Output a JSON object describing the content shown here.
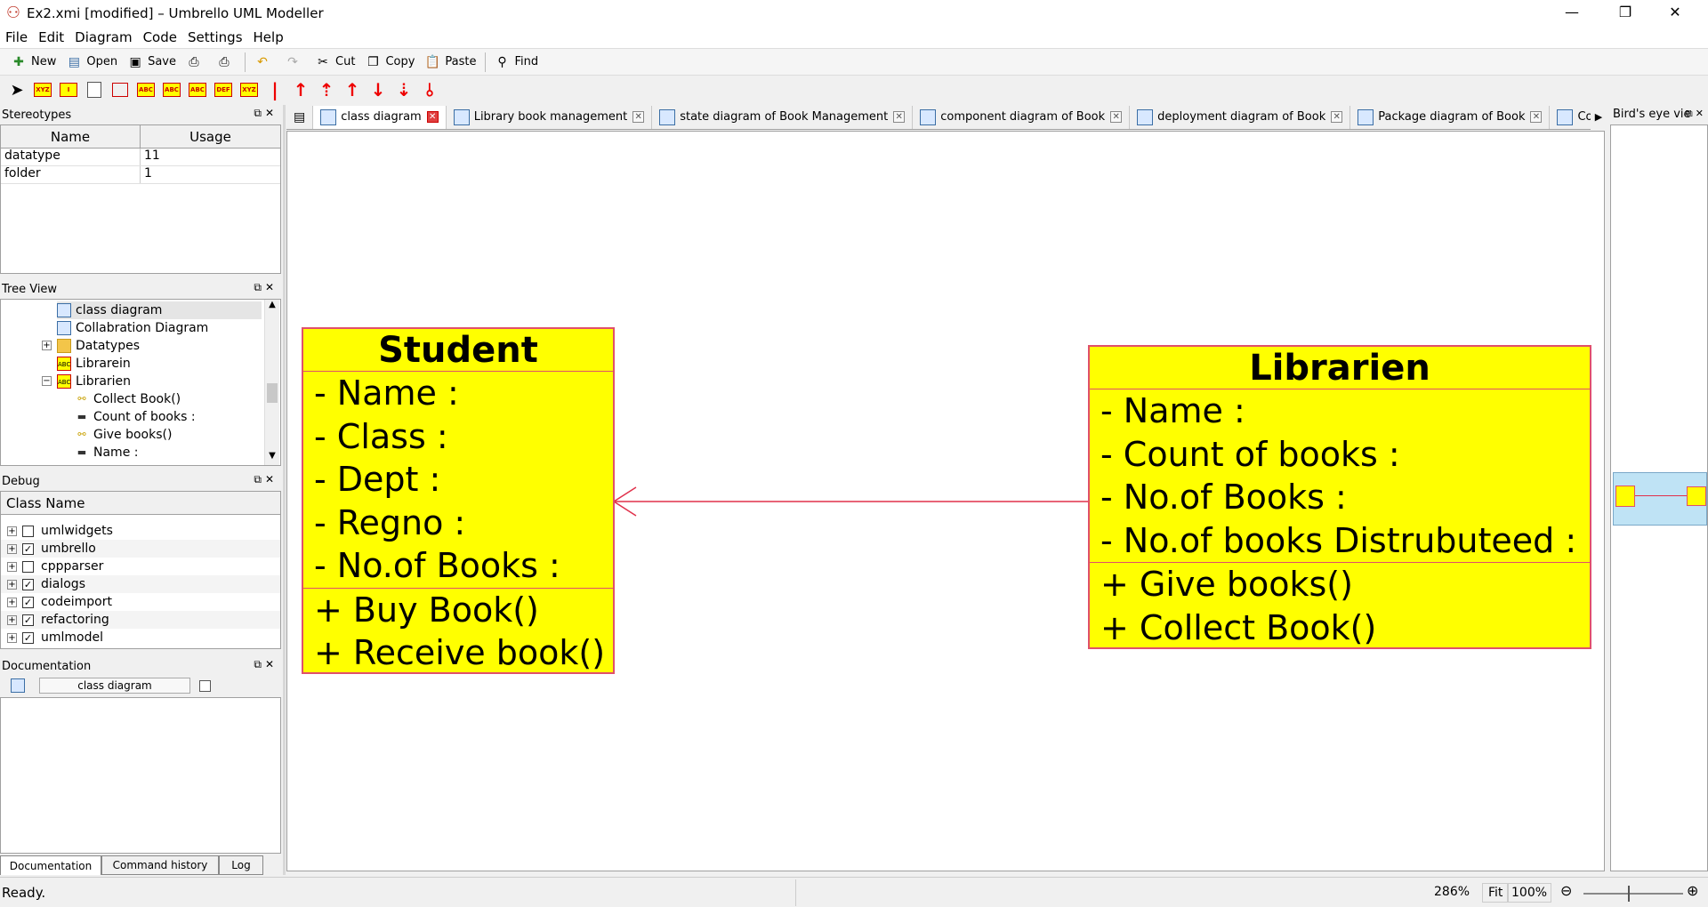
{
  "window": {
    "title": "Ex2.xmi [modified] – Umbrello UML Modeller",
    "minimize": "—",
    "restore": "❐",
    "close": "✕"
  },
  "menu": [
    "File",
    "Edit",
    "Diagram",
    "Code",
    "Settings",
    "Help"
  ],
  "toolbar": {
    "new": "New",
    "open": "Open",
    "save": "Save",
    "cut": "Cut",
    "copy": "Copy",
    "paste": "Paste",
    "find": "Find"
  },
  "stereotypes": {
    "title": "Stereotypes",
    "col_name": "Name",
    "col_usage": "Usage",
    "rows": [
      {
        "name": "datatype",
        "usage": "11"
      },
      {
        "name": "folder",
        "usage": "1"
      }
    ]
  },
  "tree": {
    "title": "Tree View",
    "items": [
      {
        "label": "class diagram",
        "icon": "diagram-icon"
      },
      {
        "label": "Collabration Diagram",
        "icon": "diagram-icon"
      },
      {
        "label": "Datatypes",
        "icon": "folder-icon"
      },
      {
        "label": "Librarein",
        "icon": "class-icon"
      },
      {
        "label": "Librarien",
        "icon": "class-icon"
      },
      {
        "label": "Collect Book()",
        "icon": "operation-icon"
      },
      {
        "label": "Count of books :",
        "icon": "attribute-icon"
      },
      {
        "label": "Give books()",
        "icon": "operation-icon"
      },
      {
        "label": "Name :",
        "icon": "attribute-icon"
      }
    ]
  },
  "debug": {
    "title": "Debug",
    "col_header": "Class Name",
    "rows": [
      {
        "label": "umlwidgets",
        "checked": false
      },
      {
        "label": "umbrello",
        "checked": true
      },
      {
        "label": "cppparser",
        "checked": false
      },
      {
        "label": "dialogs",
        "checked": true
      },
      {
        "label": "codeimport",
        "checked": true
      },
      {
        "label": "refactoring",
        "checked": true
      },
      {
        "label": "umlmodel",
        "checked": true
      }
    ]
  },
  "documentation": {
    "title": "Documentation",
    "field": "class diagram",
    "tabs": [
      "Documentation",
      "Command history",
      "Log"
    ]
  },
  "tabs": [
    "class diagram",
    "Library book management",
    "state diagram of Book Management",
    "component diagram of Book",
    "deployment diagram of Book",
    "Package diagram of Book",
    "Co"
  ],
  "diagram": {
    "student": {
      "name": "Student",
      "attributes": [
        "- Name :",
        "- Class :",
        "- Dept :",
        "- Regno :",
        "- No.of Books :"
      ],
      "operations": [
        "+ Buy Book()",
        "+ Receive book()"
      ]
    },
    "librarien": {
      "name": "Librarien",
      "attributes": [
        "- Name :",
        "- Count of books :",
        "- No.of Books :",
        "- No.of books Distrubuteed :"
      ],
      "operations": [
        "+ Give books()",
        "+ Collect Book()"
      ]
    },
    "association_color": "#e0304a",
    "class_fill": "#ffff00",
    "class_border": "#e0506a"
  },
  "birdseye": {
    "title": "Bird's eye vie"
  },
  "status": {
    "text": "Ready.",
    "zoom": "286%",
    "fit": "Fit",
    "hundred": "100%"
  }
}
